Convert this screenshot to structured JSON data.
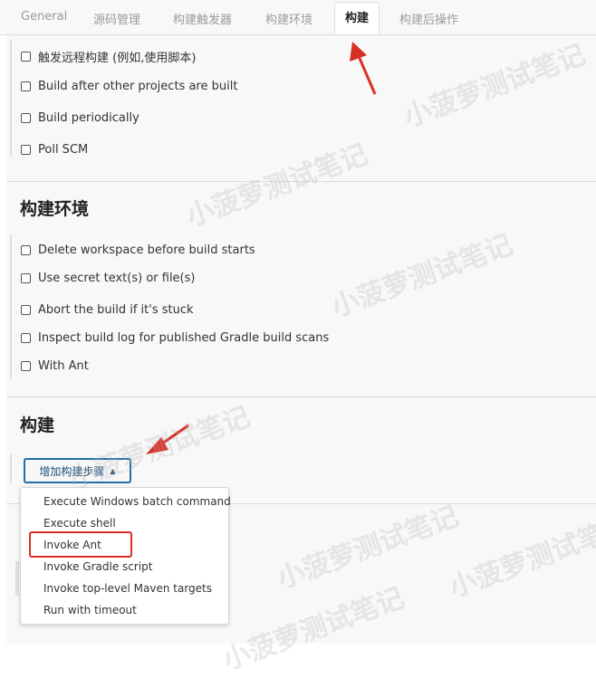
{
  "tabs": [
    {
      "label": "General"
    },
    {
      "label": "源码管理"
    },
    {
      "label": "构建触发器"
    },
    {
      "label": "构建环境"
    },
    {
      "label": "构建"
    },
    {
      "label": "构建后操作"
    }
  ],
  "triggers": {
    "items": [
      {
        "label": "触发远程构建 (例如,使用脚本)",
        "checked": false
      },
      {
        "label": "Build after other projects are built",
        "checked": false
      },
      {
        "label": "Build periodically",
        "checked": false
      },
      {
        "label": "Poll SCM",
        "checked": false
      }
    ]
  },
  "build_env": {
    "title": "构建环境",
    "items": [
      {
        "label": "Delete workspace before build starts",
        "checked": false
      },
      {
        "label": "Use secret text(s) or file(s)",
        "checked": false
      },
      {
        "label": "Abort the build if it's stuck",
        "checked": false
      },
      {
        "label": "Inspect build log for published Gradle build scans",
        "checked": false
      },
      {
        "label": "With Ant",
        "checked": false
      }
    ]
  },
  "build": {
    "title": "构建",
    "add_step_label": "增加构建步骤",
    "menu": [
      {
        "label": "Execute Windows batch command"
      },
      {
        "label": "Execute shell"
      },
      {
        "label": "Invoke Ant"
      },
      {
        "label": "Invoke Gradle script"
      },
      {
        "label": "Invoke top-level Maven targets"
      },
      {
        "label": "Run with timeout"
      }
    ]
  },
  "watermark_text": "小菠萝测试笔记",
  "colors": {
    "annotation_red": "#d93025",
    "button_border": "#1f6fa5"
  }
}
